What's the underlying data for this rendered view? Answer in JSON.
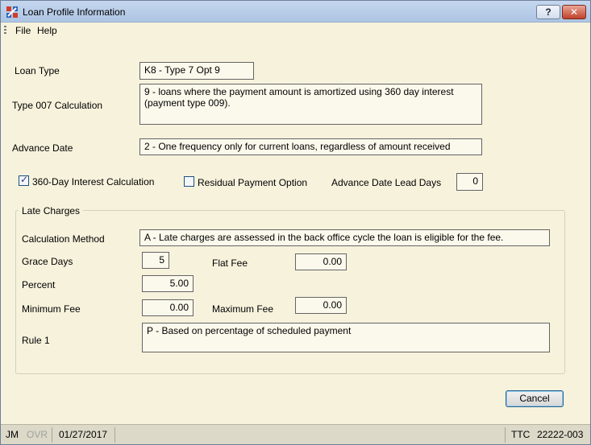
{
  "window": {
    "title": "Loan Profile Information"
  },
  "titlebar": {
    "help_label": "?",
    "close_label": "✕"
  },
  "menu": {
    "file": "File",
    "help": "Help"
  },
  "form": {
    "loan_type_label": "Loan Type",
    "loan_type_value": "K8 - Type 7 Opt 9",
    "type007_label": "Type 007 Calculation",
    "type007_value": "9 - loans where the payment amount is amortized using 360 day interest (payment type 009).",
    "advance_date_label": "Advance Date",
    "advance_date_value": "2 - One frequency only for current loans, regardless of amount received",
    "interest360_label": "360-Day Interest Calculation",
    "interest360_checked": true,
    "residual_label": "Residual Payment Option",
    "residual_checked": false,
    "lead_days_label": "Advance Date Lead Days",
    "lead_days_value": "0"
  },
  "late_charges": {
    "group_title": "Late Charges",
    "calc_method_label": "Calculation Method",
    "calc_method_value": "A - Late charges are assessed in the back office cycle the loan is eligible for the fee.",
    "grace_days_label": "Grace Days",
    "grace_days_value": "5",
    "flat_fee_label": "Flat Fee",
    "flat_fee_value": "0.00",
    "percent_label": "Percent",
    "percent_value": "5.00",
    "min_fee_label": "Minimum Fee",
    "min_fee_value": "0.00",
    "max_fee_label": "Maximum Fee",
    "max_fee_value": "0.00",
    "rule1_label": "Rule 1",
    "rule1_value": "P - Based on percentage of scheduled payment"
  },
  "buttons": {
    "cancel": "Cancel"
  },
  "statusbar": {
    "user": "JM",
    "mode": "OVR",
    "date": "01/27/2017",
    "ttc_label": "TTC",
    "ttc_value": "22222-003"
  },
  "icons": {
    "app": "app-logo-icon",
    "help": "help-icon",
    "close": "close-icon",
    "check": "check-icon"
  }
}
